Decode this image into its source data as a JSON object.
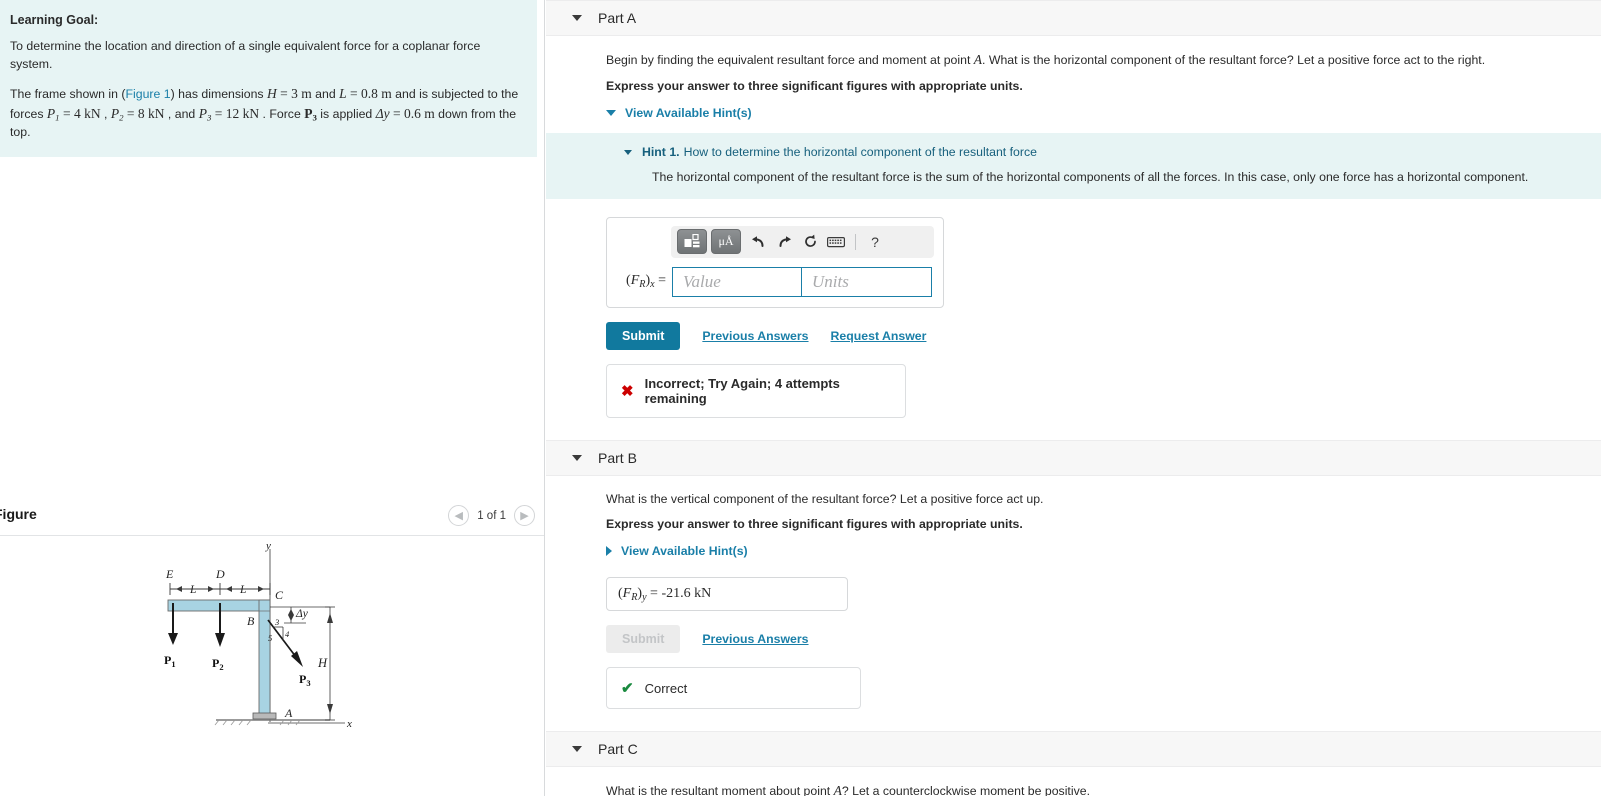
{
  "left": {
    "goal": {
      "title": "Learning Goal:",
      "paragraph1": "To determine the location and direction of a single equivalent force for a coplanar force system.",
      "p2_a": "The frame shown in (",
      "p2_figure_link": "Figure 1",
      "p2_b": ") has dimensions ",
      "H_sym": "H",
      "H_val": " = 3 m",
      "and1": " and ",
      "L_sym": "L",
      "L_val": " = 0.8 m",
      "p2_c": " and is subjected to the forces ",
      "P1_sym": "P",
      "P1_sub": "1",
      "P1_val": " = 4 kN",
      "comma1": " , ",
      "P2_sym": "P",
      "P2_sub": "2",
      "P2_val": " = 8 kN",
      "comma2": " , and ",
      "P3_sym": "P",
      "P3_sub": "3",
      "P3_val": " = 12 kN",
      "p2_d": " . Force ",
      "P3b_sym": "P",
      "P3b_sub": "3",
      "p2_e": " is applied ",
      "dy_sym": "Δy",
      "dy_val": " = 0.6 m",
      "p2_f": " down from the top."
    },
    "figure": {
      "title": "Figure",
      "count": "1 of 1",
      "prev_icon": "chevron-left-icon",
      "next_icon": "chevron-right-icon",
      "labels": {
        "E": "E",
        "D": "D",
        "C": "C",
        "B": "B",
        "A": "A",
        "H": "H",
        "L1": "L",
        "L2": "L",
        "dy": "Δy",
        "P1": "P",
        "P1_sub": "1",
        "P2": "P",
        "P2_sub": "2",
        "P3": "P",
        "P3_sub": "3",
        "x_axis": "x",
        "y_axis": "y",
        "slope_3": "3",
        "slope_4": "4",
        "slope_5": "5"
      },
      "beam_color": "#a8d3e2"
    }
  },
  "parts": {
    "a": {
      "label": "Part A",
      "question": "Begin by finding the equivalent resultant force and moment at point ",
      "question_sym": "A",
      "question_tail": ". What is the horizontal component of the resultant force? Let a positive force act to the right.",
      "instruction": "Express your answer to three significant figures with appropriate units.",
      "hints_link": "View Available Hint(s)",
      "hint": {
        "number": "Hint 1.",
        "heading": "How to determine the horizontal component of the resultant force",
        "text": "The horizontal component of the resultant force is the sum of the horizontal components of all the forces. In this case, only one force has a horizontal component."
      },
      "toolbar": {
        "template_icon": "math-template-icon",
        "units_icon": "micro-angstrom-units-icon",
        "units_text": "μÅ",
        "undo_icon": "undo-icon",
        "redo_icon": "redo-icon",
        "reset_icon": "reset-icon",
        "keyboard_icon": "keyboard-icon",
        "help_icon": "help-icon",
        "help_text": "?"
      },
      "answer_label_base": "F",
      "answer_label_sub": "R",
      "answer_label_comp": "x",
      "value_placeholder": "Value",
      "units_placeholder": "Units",
      "submit": "Submit",
      "previous_answers": "Previous Answers",
      "request_answer": "Request Answer",
      "feedback_mark": "✖",
      "feedback": "Incorrect; Try Again; 4 attempts remaining"
    },
    "b": {
      "label": "Part B",
      "question": "What is the vertical component of the resultant force? Let a positive force act up.",
      "instruction": "Express your answer to three significant figures with appropriate units.",
      "hints_link": "View Available Hint(s)",
      "answer_label_base": "F",
      "answer_label_sub": "R",
      "answer_label_comp": "y",
      "answer_value": "-21.6 kN",
      "submit": "Submit",
      "previous_answers": "Previous Answers",
      "feedback_mark": "✔",
      "feedback": "Correct"
    },
    "c": {
      "label": "Part C",
      "question": "What is the resultant moment about point ",
      "question_sym": "A",
      "question_tail": "? Let a counterclockwise moment be positive."
    }
  },
  "colors": {
    "accent": "#1a7fa8",
    "submit": "#11799e",
    "hint_bg": "#e7f4f4",
    "incorrect": "#cc0000",
    "correct": "#1a8a3f"
  }
}
